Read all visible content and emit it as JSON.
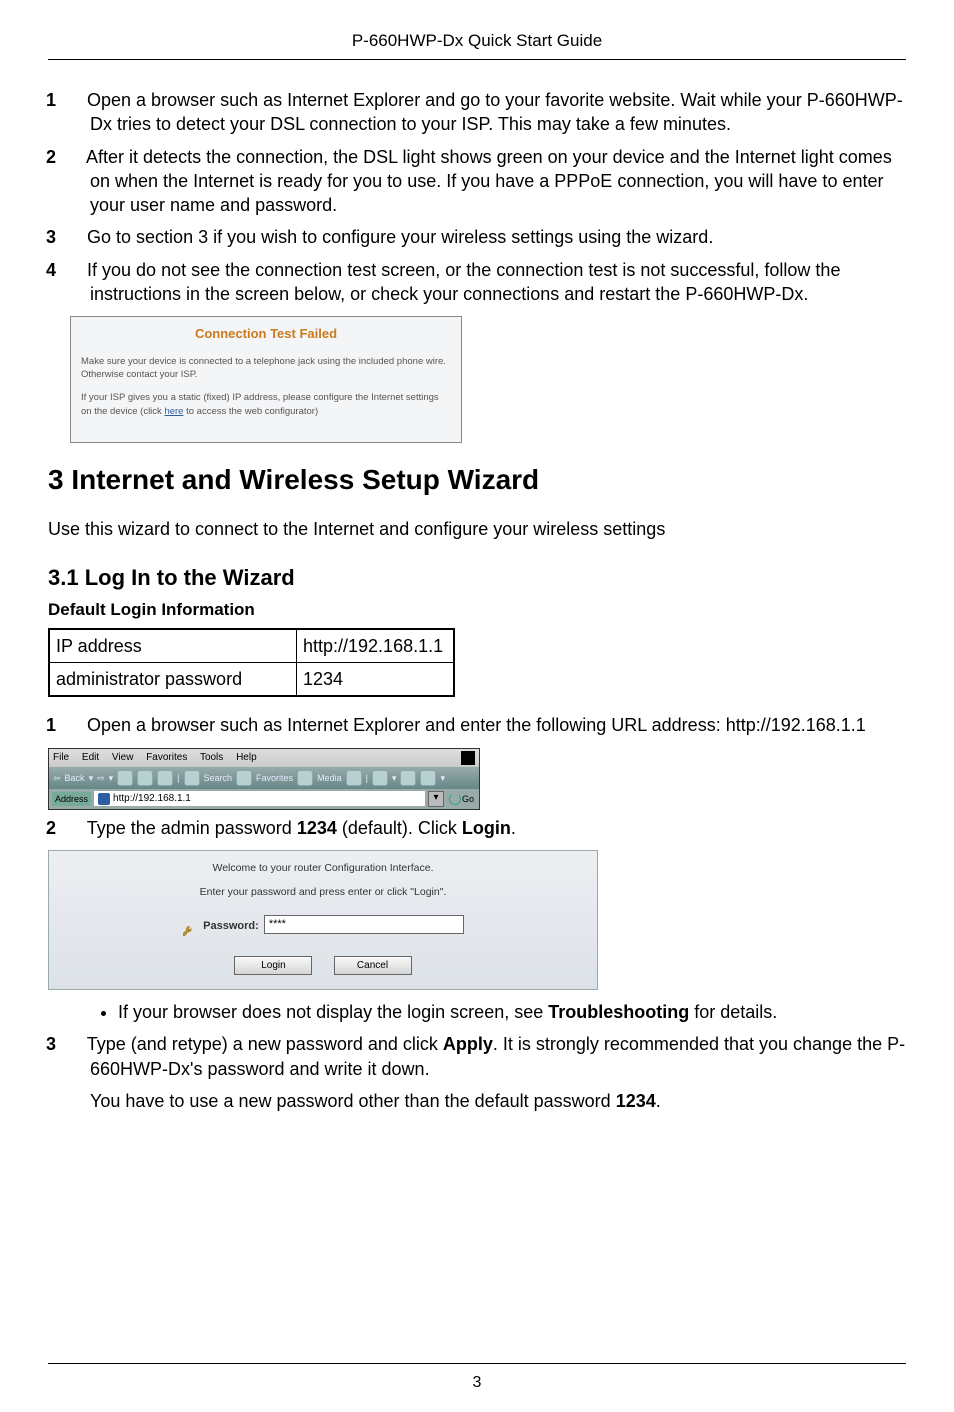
{
  "header": {
    "title": "P-660HWP-Dx Quick Start Guide"
  },
  "steps_top": [
    "Open a browser such as Internet Explorer and go to your favorite website. Wait while your P-660HWP-Dx tries to detect your DSL connection to your ISP. This may take a few minutes.",
    "After it detects the connection, the DSL light shows green on your device and the Internet light comes on when the Internet is ready for you to use. If you have a PPPoE connection, you will have to enter your user name and password.",
    "Go to section 3 if you wish to configure your wireless settings using the wizard.",
    "If you do not see the connection test screen, or the connection test is not successful, follow the instructions in the screen below, or check your connections and restart the P-660HWP-Dx."
  ],
  "fig1": {
    "title": "Connection Test Failed",
    "p1": "Make sure your device is connected to a telephone jack using the included phone wire. Otherwise contact your ISP.",
    "p2_a": "If your ISP gives you a static (fixed) IP address, please configure the Internet settings on the device (click ",
    "p2_link": "here",
    "p2_b": " to access the web configurator)"
  },
  "section3": {
    "heading": "3 Internet and Wireless Setup Wizard",
    "lead": "Use this wizard to connect to the Internet and configure your wireless settings"
  },
  "section31": {
    "heading": "3.1 Log In to the Wizard",
    "caption": "Default Login Information",
    "table": {
      "r1l": "IP address",
      "r1r": "http://192.168.1.1",
      "r2l": "administrator password",
      "r2r": "1234"
    }
  },
  "steps_bottom": {
    "s1": "Open a browser such as Internet Explorer and enter the following URL address: http://192.168.1.1",
    "s2_a": "Type the admin password ",
    "s2_b": "1234",
    "s2_c": " (default). Click ",
    "s2_d": "Login",
    "s2_e": ".",
    "bullet_a": "If your browser does not display the login screen, see ",
    "bullet_b": "Troubleshooting",
    "bullet_c": " for details.",
    "s3_a": "Type (and retype) a new password and click ",
    "s3_b": "Apply",
    "s3_c": ". It is strongly recommended that you change the P-660HWP-Dx's password and write it down.",
    "s3_p2_a": "You have to use a new password other than the default password ",
    "s3_p2_b": "1234",
    "s3_p2_c": "."
  },
  "fig_browser": {
    "menus": [
      "File",
      "Edit",
      "View",
      "Favorites",
      "Tools",
      "Help"
    ],
    "back": "Back",
    "tb": [
      "Search",
      "Favorites",
      "Media"
    ],
    "addr_label": "Address",
    "addr_value": "http://192.168.1.1",
    "go": "Go"
  },
  "fig_login": {
    "line1": "Welcome to your router Configuration Interface.",
    "line2": "Enter your password and press enter or click \"Login\".",
    "pw_label": "Password:",
    "pw_value": "****",
    "login": "Login",
    "cancel": "Cancel"
  },
  "footer": {
    "page": "3"
  }
}
